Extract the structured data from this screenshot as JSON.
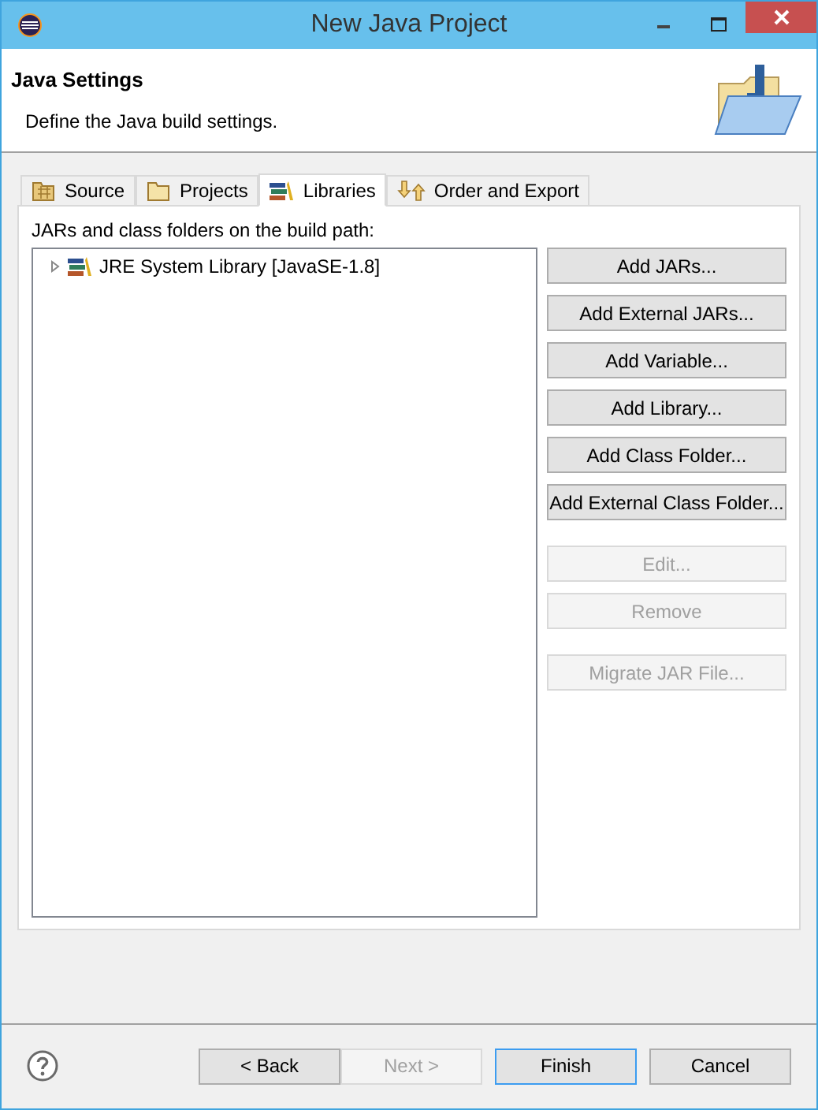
{
  "window": {
    "title": "New Java Project"
  },
  "header": {
    "title": "Java Settings",
    "description": "Define the Java build settings."
  },
  "tabs": [
    {
      "label": "Source",
      "selected": false
    },
    {
      "label": "Projects",
      "selected": false
    },
    {
      "label": "Libraries",
      "selected": true
    },
    {
      "label": "Order and Export",
      "selected": false
    }
  ],
  "libraries": {
    "label": "JARs and class folders on the build path:",
    "tree": [
      {
        "label": "JRE System Library [JavaSE-1.8]",
        "expanded": false
      }
    ],
    "button_groups": [
      [
        {
          "label": "Add JARs...",
          "disabled": false
        },
        {
          "label": "Add External JARs...",
          "disabled": false
        },
        {
          "label": "Add Variable...",
          "disabled": false
        },
        {
          "label": "Add Library...",
          "disabled": false
        },
        {
          "label": "Add Class Folder...",
          "disabled": false
        },
        {
          "label": "Add External Class Folder...",
          "disabled": false
        }
      ],
      [
        {
          "label": "Edit...",
          "disabled": true
        },
        {
          "label": "Remove",
          "disabled": true
        }
      ],
      [
        {
          "label": "Migrate JAR File...",
          "disabled": true
        }
      ]
    ]
  },
  "footer": {
    "buttons": [
      {
        "label": "< Back",
        "disabled": false,
        "default": false
      },
      {
        "label": "Next >",
        "disabled": true,
        "default": false
      },
      {
        "label": "Finish",
        "disabled": false,
        "default": true
      },
      {
        "label": "Cancel",
        "disabled": false,
        "default": false
      }
    ]
  }
}
